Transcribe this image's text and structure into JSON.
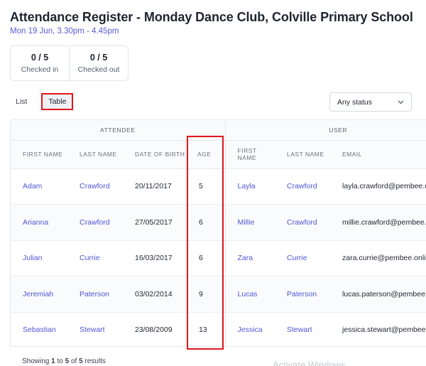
{
  "page": {
    "title": "Attendance Register - Monday Dance Club, Colville Primary School",
    "subtitle": "Mon 19 Jun, 3.30pm - 4.45pm"
  },
  "stats": [
    {
      "value": "0 / 5",
      "label": "Checked in"
    },
    {
      "value": "0 / 5",
      "label": "Checked out"
    }
  ],
  "view_toggle": {
    "list": "List",
    "table": "Table",
    "active": "Table"
  },
  "status_filter": {
    "value": "Any status"
  },
  "table": {
    "groups": {
      "attendee": "ATTENDEE",
      "user": "USER"
    },
    "columns": {
      "attendee_first": "FIRST NAME",
      "attendee_last": "LAST NAME",
      "dob": "DATE OF BIRTH",
      "age": "AGE",
      "user_first": "FIRST NAME",
      "user_last": "LAST NAME",
      "email": "EMAIL"
    },
    "rows": [
      {
        "first": "Adam",
        "last": "Crawford",
        "dob": "20/11/2017",
        "age": "5",
        "user_first": "Layla",
        "user_last": "Crawford",
        "email": "layla.crawford@pembee.c"
      },
      {
        "first": "Arianna",
        "last": "Crawford",
        "dob": "27/05/2017",
        "age": "6",
        "user_first": "Millie",
        "user_last": "Crawford",
        "email": "millie.crawford@pembee.c"
      },
      {
        "first": "Julian",
        "last": "Currie",
        "dob": "16/03/2017",
        "age": "6",
        "user_first": "Zara",
        "user_last": "Currie",
        "email": "zara.currie@pembee.onlin"
      },
      {
        "first": "Jeremiah",
        "last": "Paterson",
        "dob": "03/02/2014",
        "age": "9",
        "user_first": "Lucas",
        "user_last": "Paterson",
        "email": "lucas.paterson@pembee.c"
      },
      {
        "first": "Sebastian",
        "last": "Stewart",
        "dob": "23/08/2009",
        "age": "13",
        "user_first": "Jessica",
        "user_last": "Stewart",
        "email": "jessica.stewart@pembee."
      }
    ]
  },
  "footer": {
    "prefix": "Showing ",
    "from": "1",
    "to_word": " to ",
    "to": "5",
    "of_word": " of ",
    "total": "5",
    "suffix": " results"
  },
  "watermark": "Activate Windows",
  "colors": {
    "accent": "#5b5bd6",
    "link": "#4f55d8",
    "highlight": "#e0161c"
  }
}
